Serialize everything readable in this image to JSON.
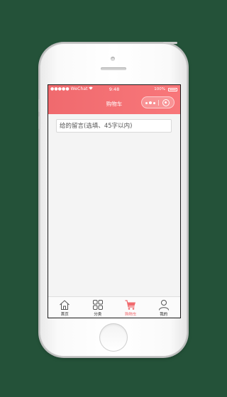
{
  "status_bar": {
    "carrier": "●●●●● WeChat",
    "time": "9:48",
    "battery": "100%"
  },
  "nav": {
    "title": "购物车"
  },
  "message": {
    "placeholder": "给的留言(选填、45字以内)",
    "value": ""
  },
  "tabs": [
    {
      "label": "首页",
      "icon": "home-icon",
      "active": false
    },
    {
      "label": "分类",
      "icon": "grid-icon",
      "active": false
    },
    {
      "label": "购物车",
      "icon": "cart-icon",
      "active": true
    },
    {
      "label": "我的",
      "icon": "user-icon",
      "active": false
    }
  ],
  "colors": {
    "accent": "#f06a6e",
    "background": "#245239",
    "content_bg": "#f4f4f4"
  }
}
